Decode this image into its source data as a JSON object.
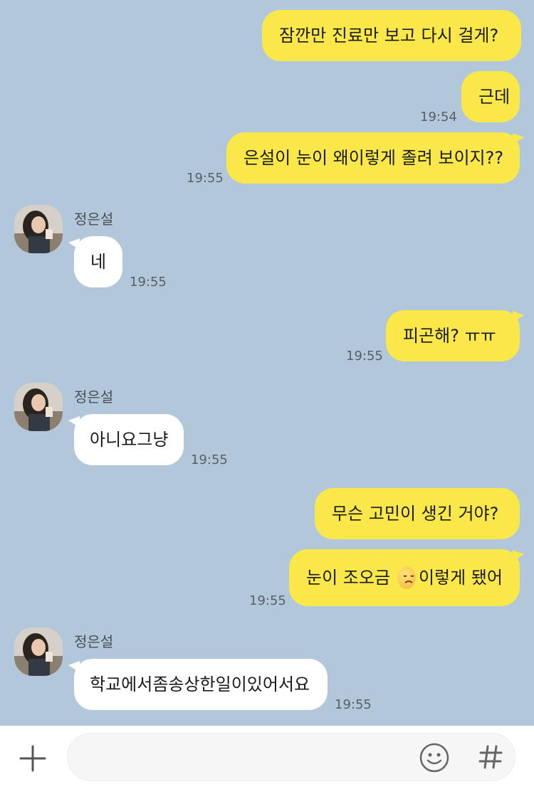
{
  "messages": [
    {
      "text": "잠깐만 진료만 보고 다시 걸게?"
    },
    {
      "text": "근데",
      "time": "19:54"
    },
    {
      "text": "은설이 눈이 왜이렇게 졸려 보이지??",
      "time": "19:55"
    },
    {
      "sender": "정은설",
      "text": "네",
      "time": "19:55"
    },
    {
      "text": "피곤해? ㅠㅠ",
      "time": "19:55"
    },
    {
      "sender": "정은설",
      "text": "아니요그냥",
      "time": "19:55"
    },
    {
      "text": "무슨 고민이 생긴 거야?"
    },
    {
      "text_before": "눈이 조오금",
      "emoji": "disappointed-face",
      "text_after": "이렇게 됐어",
      "time": "19:55"
    },
    {
      "sender": "정은설",
      "text": "학교에서좀송상한일이있어서요",
      "time": "19:55"
    }
  ],
  "input": {
    "placeholder": "",
    "value": ""
  },
  "colors": {
    "background": "#b2c7d9",
    "my_bubble": "#fae84b",
    "their_bubble": "#ffffff"
  }
}
